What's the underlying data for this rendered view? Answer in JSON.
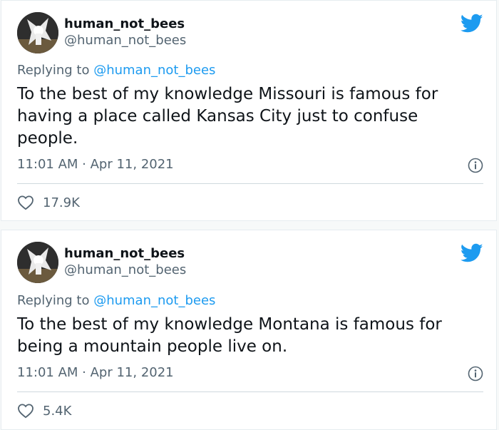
{
  "tweets": [
    {
      "display_name": "human_not_bees",
      "handle": "@human_not_bees",
      "replying_prefix": "Replying to ",
      "replying_handle": "@human_not_bees",
      "text": "To the best of my knowledge Missouri is famous for having a place called Kansas City just to confuse people.",
      "timestamp": "11:01 AM · Apr 11, 2021",
      "likes": "17.9K"
    },
    {
      "display_name": "human_not_bees",
      "handle": "@human_not_bees",
      "replying_prefix": "Replying to ",
      "replying_handle": "@human_not_bees",
      "text": "To the best of my knowledge Montana is famous for being a mountain people live on.",
      "timestamp": "11:01 AM · Apr 11, 2021",
      "likes": "5.4K"
    }
  ],
  "colors": {
    "accent": "#1d9bf0",
    "muted": "#536471",
    "text": "#0f1419"
  },
  "icons": [
    "twitter-bird-icon",
    "info-icon",
    "heart-icon"
  ]
}
